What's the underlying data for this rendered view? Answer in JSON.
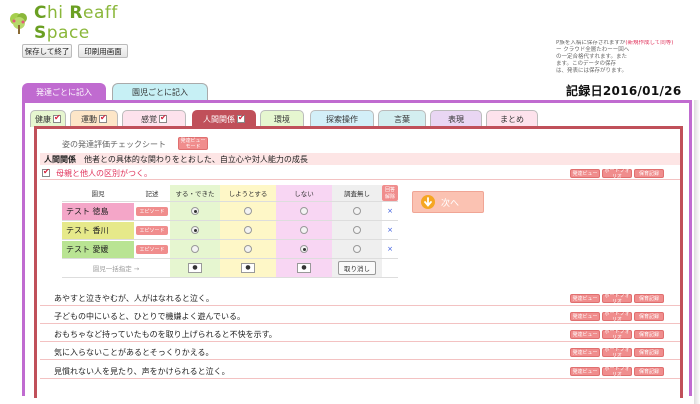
{
  "app": {
    "logo_text": "Chi Reaff Space",
    "logo_parts": [
      "C",
      "hi ",
      "R",
      "eaff ",
      "S",
      "pace"
    ]
  },
  "toolbar": {
    "save_exit": "保存して終了",
    "print_screen": "印刷用画面"
  },
  "notice": {
    "lines": [
      "P族を入稿に保存されますが",
      "ー クラウド全層たわーー回へ",
      "の一定合格代すれます。また",
      "ます。このデータの保存",
      "は、発表には保存がります。"
    ],
    "red_line": "(新規作成して同等)"
  },
  "main_tabs": [
    {
      "label": "発達ごとに記入",
      "active": true
    },
    {
      "label": "園児ごとに記入",
      "active": false
    }
  ],
  "record_date": "記録日2016/01/26",
  "sub_tabs": [
    {
      "label": "健康",
      "checked": true,
      "color": "#e6f6d0"
    },
    {
      "label": "運動",
      "checked": true,
      "color": "#fde6c8"
    },
    {
      "label": "感覚",
      "checked": true,
      "color": "#fde2ec"
    },
    {
      "label": "人間関係",
      "checked": true,
      "color": "#c0505a",
      "active": true
    },
    {
      "label": "環境",
      "checked": false,
      "color": "#e6f6d0"
    },
    {
      "label": "探索操作",
      "checked": false,
      "color": "#d3eff8"
    },
    {
      "label": "言葉",
      "checked": false,
      "color": "#d3eef0"
    },
    {
      "label": "表現",
      "checked": false,
      "color": "#e9d6f3"
    },
    {
      "label": "まとめ",
      "checked": false,
      "color": "#fde2ec"
    }
  ],
  "sheet": {
    "title": "姿の発達評価チェックシート",
    "review_btn": "発達ビュー\nモード",
    "section_name": "人間関係",
    "section_desc": "他者との具体的な関わりをとおした、自立心や対人能力の成長",
    "item_title": "母親と他人の区別がつく。",
    "side_buttons": [
      "発達ビュー",
      "ポートフォリオ",
      "保育記録"
    ]
  },
  "grid": {
    "headers": {
      "name": "園児",
      "record": "記述",
      "can": "する・できた",
      "try": "しようとする",
      "no": "しない",
      "unk": "調査無し",
      "clear": "回答解除"
    },
    "episode_label": "エピソード",
    "rows": [
      {
        "name": "テスト 徳島",
        "selected": "can"
      },
      {
        "name": "テスト 香川",
        "selected": "can"
      },
      {
        "name": "テスト 愛媛",
        "selected": "no"
      }
    ],
    "bulk_label": "園児一括指定 →",
    "bulk_buttons": [
      "●",
      "●",
      "●"
    ],
    "cancel_label": "取り消し",
    "x_mark": "×"
  },
  "next_button": "次へ",
  "items": [
    "あやすと泣きやむが、人がはなれると泣く。",
    "子どもの中にいると、ひとりで機嫌よく遊んでいる。",
    "おもちゃなど持っていたものを取り上げられると不快を示す。",
    "気に入らないことがあるとそっくりかえる。",
    "見慣れない人を見たり、声をかけられると泣く。"
  ],
  "colors": {
    "frame_purple": "#c06bd0",
    "panel_red": "#c0505a",
    "accent_pink": "#f08d8d",
    "logo_green": "#8ab73a"
  }
}
